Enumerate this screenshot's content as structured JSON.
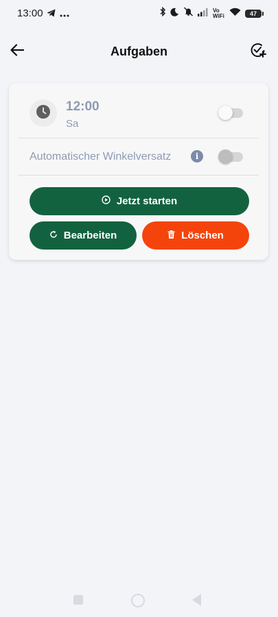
{
  "status_bar": {
    "time": "13:00",
    "left_icons": [
      "telegram-icon",
      "more-dots-icon"
    ],
    "right_icons": [
      "bluetooth-icon",
      "moon-icon",
      "bell-off-icon",
      "signal-icon",
      "vowifi-icon",
      "wifi-icon",
      "battery-icon"
    ],
    "vowifi_label": "Vo WiFi",
    "battery_level": "47"
  },
  "app_bar": {
    "title": "Aufgaben",
    "back_icon": "arrow-left-icon",
    "add_icon": "check-circle-add-icon"
  },
  "task_card": {
    "time": "12:00",
    "day": "Sa",
    "enabled": false,
    "auto_offset_label": "Automatischer Winkelversatz",
    "auto_offset_enabled": false,
    "buttons": {
      "start": "Jetzt starten",
      "edit": "Bearbeiten",
      "delete": "Löschen"
    }
  },
  "colors": {
    "primary_green": "#13623f",
    "delete_red": "#f5440b",
    "muted_text": "#8f9bb3",
    "background": "#f3f4f8"
  }
}
